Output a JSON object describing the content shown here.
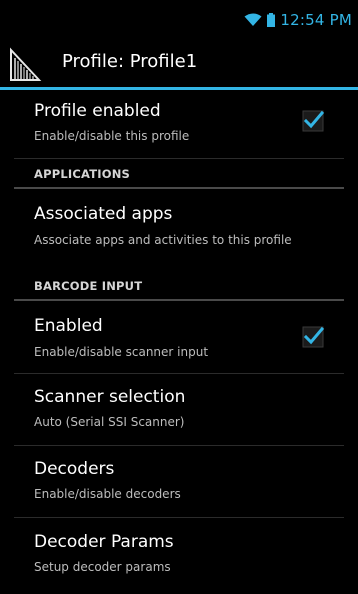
{
  "status_bar": {
    "time": "12:54 PM",
    "icons": [
      "wifi-icon",
      "battery-icon"
    ],
    "accent_color": "#33b5e5"
  },
  "action_bar": {
    "title": "Profile: Profile1",
    "icon": "datawedge-app-icon"
  },
  "preferences": {
    "profile_enabled": {
      "title": "Profile enabled",
      "summary": "Enable/disable this profile",
      "checked": true
    },
    "applications_category": "APPLICATIONS",
    "associated_apps": {
      "title": "Associated apps",
      "summary": "Associate apps and activities to this profile"
    },
    "barcode_input_category": "BARCODE INPUT",
    "scanner_enabled": {
      "title": "Enabled",
      "summary": "Enable/disable scanner input",
      "checked": true
    },
    "scanner_selection": {
      "title": "Scanner selection",
      "summary": "Auto (Serial SSI Scanner)"
    },
    "decoders": {
      "title": "Decoders",
      "summary": "Enable/disable decoders"
    },
    "decoder_params": {
      "title": "Decoder Params",
      "summary": "Setup decoder params"
    }
  }
}
